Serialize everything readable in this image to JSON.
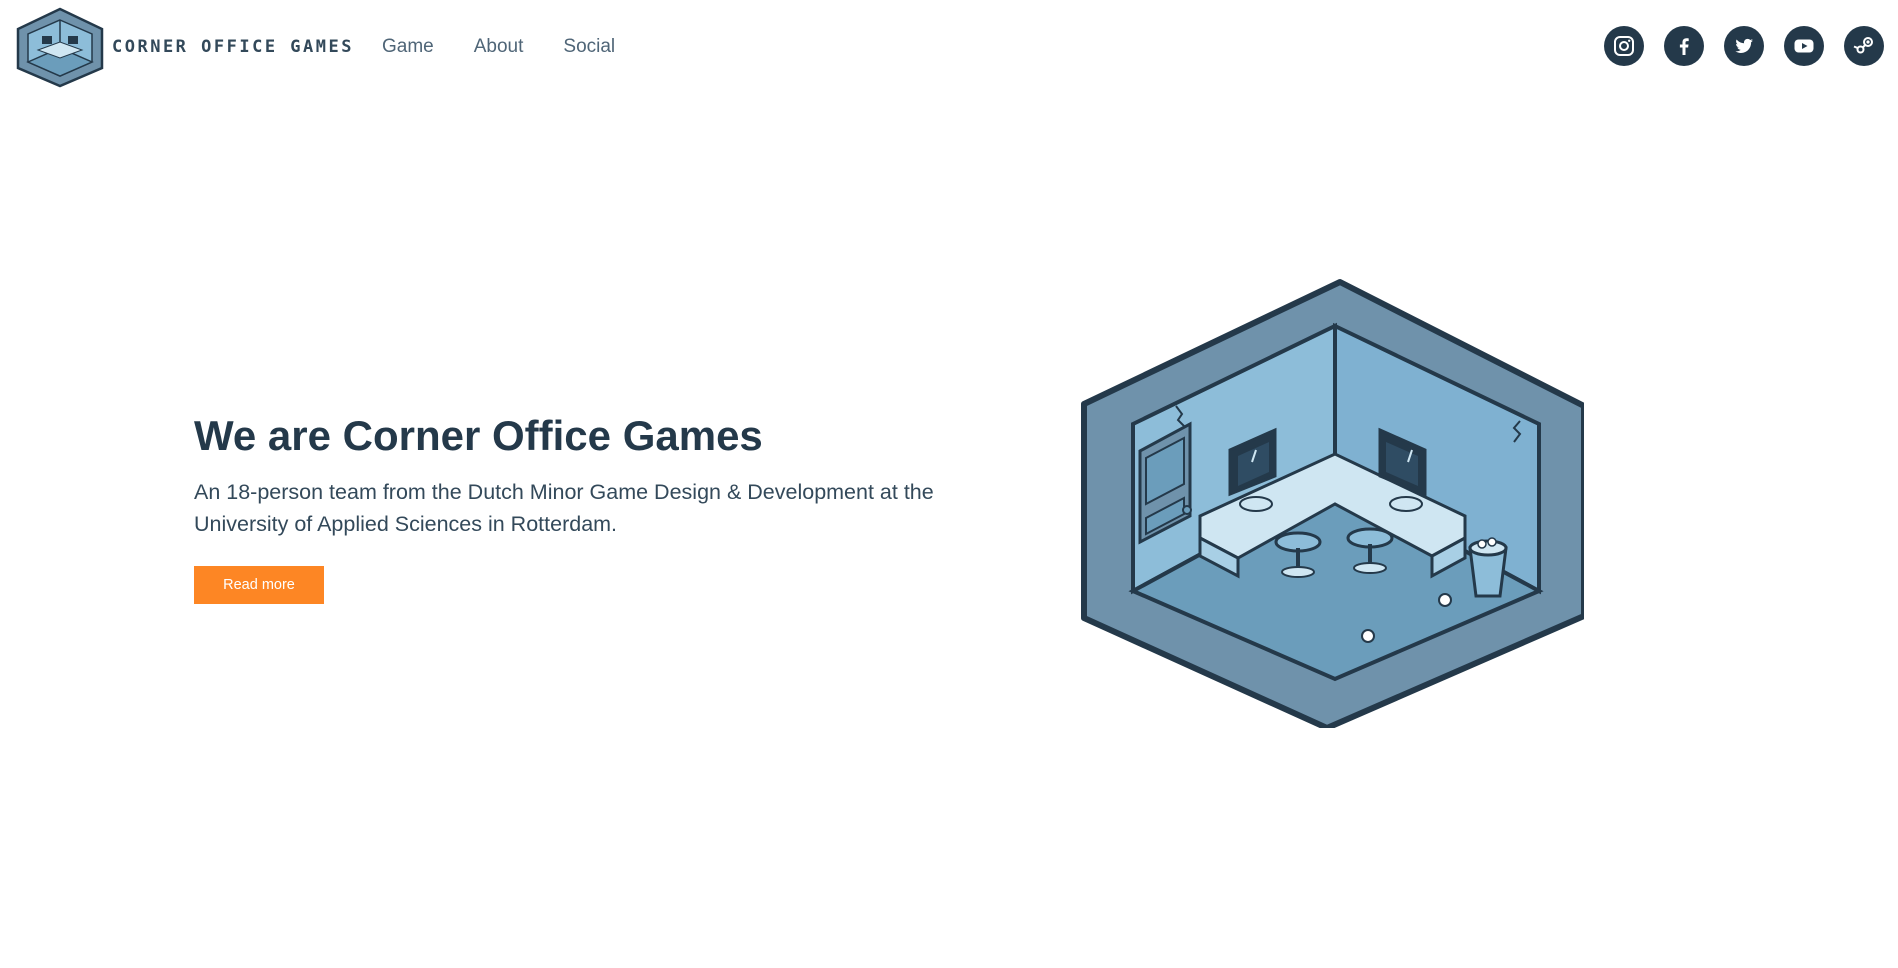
{
  "brand": {
    "name": "Corner Office Games"
  },
  "nav": {
    "items": [
      {
        "label": "Game"
      },
      {
        "label": "About"
      },
      {
        "label": "Social"
      }
    ]
  },
  "social": {
    "icons": [
      "instagram-icon",
      "facebook-icon",
      "twitter-icon",
      "youtube-icon",
      "steam-icon"
    ]
  },
  "hero": {
    "title": "We are Corner Office Games",
    "subtitle": "An 18-person team from the Dutch Minor Game Design & Development at the University of Applied Sciences in Rotterdam.",
    "button_label": "Read more"
  },
  "colors": {
    "primary_text": "#24394a",
    "accent": "#fd8624",
    "illustration_light": "#8dbdd9",
    "illustration_mid": "#6b9dbb",
    "illustration_frame": "#6f92ab"
  }
}
